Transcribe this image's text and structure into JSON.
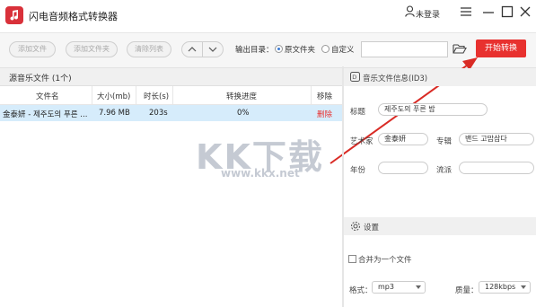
{
  "window": {
    "title": "闪电音频格式转换器",
    "login_label": "未登录"
  },
  "toolbar": {
    "add_file": "添加文件",
    "add_folder": "添加文件夹",
    "clear_list": "清除列表",
    "output_dir_label": "输出目录：",
    "option_source_folder": "原文件夹",
    "option_custom": "自定义",
    "output_dir_value": "",
    "start_button": "开始转换",
    "selected_option": "原文件夹"
  },
  "file_list": {
    "header": "源音乐文件 (1个)",
    "columns": [
      "文件名",
      "大小(mb)",
      "时长(s)",
      "转换进度",
      "移除"
    ],
    "rows": [
      {
        "name": "金泰妍 - 제주도의 푸른 ...",
        "size": "7.96 MB",
        "duration": "203s",
        "progress": "0%",
        "remove": "删除"
      }
    ]
  },
  "id3": {
    "header": "音乐文件信息(ID3)",
    "title_label": "标题",
    "title_value": "제주도의 푸른 밤",
    "artist_label": "艺术家",
    "artist_value": "金泰妍",
    "album_label": "专辑",
    "album_value": "밴드 고맙삼다",
    "year_label": "年份",
    "year_value": "",
    "genre_label": "流派",
    "genre_value": ""
  },
  "settings": {
    "header": "设置",
    "merge_label": "合并为一个文件",
    "merge_checked": false,
    "format_label": "格式：",
    "format_value": "mp3",
    "quality_label": "质量：",
    "quality_value": "128kbps"
  },
  "watermark": {
    "text": "KK下载",
    "url": "www.kkx.net"
  },
  "colors": {
    "accent": "#e8312f",
    "selected_row": "#d6ecfb",
    "logo": "#d9313a"
  }
}
